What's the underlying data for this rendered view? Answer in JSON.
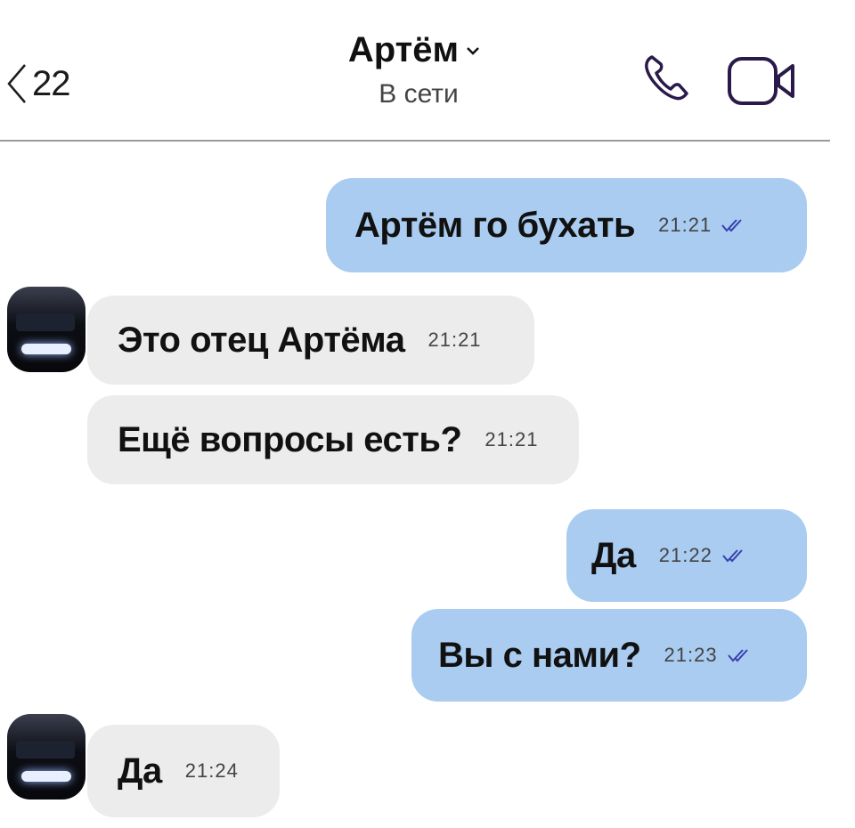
{
  "header": {
    "back_count": "22",
    "contact_name": "Артём",
    "status": "В сети",
    "icons": {
      "back": "chevron-left-icon",
      "name_dropdown": "chevron-down-icon",
      "call": "phone-icon",
      "video": "video-camera-icon"
    },
    "icon_color": "#2a1a4a"
  },
  "colors": {
    "outgoing_bubble": "#a9ccf0",
    "incoming_bubble": "#ececec",
    "read_ticks": "#3a3fb0"
  },
  "messages": [
    {
      "direction": "out",
      "text": "Артём го бухать",
      "time": "21:21",
      "read": true
    },
    {
      "direction": "in",
      "text": "Это отец Артёма",
      "time": "21:21"
    },
    {
      "direction": "in",
      "text": "Ещё вопросы есть?",
      "time": "21:21"
    },
    {
      "direction": "out",
      "text": "Да",
      "time": "21:22",
      "read": true
    },
    {
      "direction": "out",
      "text": "Вы с нами?",
      "time": "21:23",
      "read": true
    },
    {
      "direction": "in",
      "text": "Да",
      "time": "21:24"
    }
  ]
}
